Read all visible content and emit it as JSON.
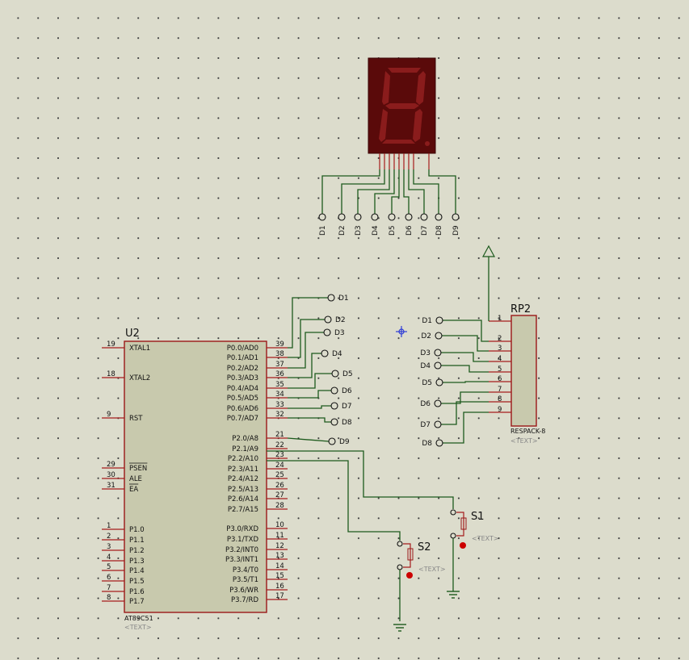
{
  "mcu": {
    "ref": "U2",
    "part": "AT89C51",
    "text": "<TEXT>",
    "pins": [
      {
        "num": "19",
        "name": "XTAL1"
      },
      {
        "num": "18",
        "name": "XTAL2"
      },
      {
        "num": "9",
        "name": "RST"
      },
      {
        "num": "29",
        "name": "PSEN"
      },
      {
        "num": "30",
        "name": "ALE"
      },
      {
        "num": "31",
        "name": "EA"
      },
      {
        "num": "1",
        "name": "P1.0"
      },
      {
        "num": "2",
        "name": "P1.1"
      },
      {
        "num": "3",
        "name": "P1.2"
      },
      {
        "num": "4",
        "name": "P1.3"
      },
      {
        "num": "5",
        "name": "P1.4"
      },
      {
        "num": "6",
        "name": "P1.5"
      },
      {
        "num": "7",
        "name": "P1.6"
      },
      {
        "num": "8",
        "name": "P1.7"
      },
      {
        "num": "39",
        "name": "P0.0/AD0"
      },
      {
        "num": "38",
        "name": "P0.1/AD1"
      },
      {
        "num": "37",
        "name": "P0.2/AD2"
      },
      {
        "num": "36",
        "name": "P0.3/AD3"
      },
      {
        "num": "35",
        "name": "P0.4/AD4"
      },
      {
        "num": "34",
        "name": "P0.5/AD5"
      },
      {
        "num": "33",
        "name": "P0.6/AD6"
      },
      {
        "num": "32",
        "name": "P0.7/AD7"
      },
      {
        "num": "21",
        "name": "P2.0/A8"
      },
      {
        "num": "22",
        "name": "P2.1/A9"
      },
      {
        "num": "23",
        "name": "P2.2/A10"
      },
      {
        "num": "24",
        "name": "P2.3/A11"
      },
      {
        "num": "25",
        "name": "P2.4/A12"
      },
      {
        "num": "26",
        "name": "P2.5/A13"
      },
      {
        "num": "27",
        "name": "P2.6/A14"
      },
      {
        "num": "28",
        "name": "P2.7/A15"
      },
      {
        "num": "10",
        "name": "P3.0/RXD"
      },
      {
        "num": "11",
        "name": "P3.1/TXD"
      },
      {
        "num": "12",
        "name": "P3.2/INT0"
      },
      {
        "num": "13",
        "name": "P3.3/INT1"
      },
      {
        "num": "14",
        "name": "P3.4/T0"
      },
      {
        "num": "15",
        "name": "P3.5/T1"
      },
      {
        "num": "16",
        "name": "P3.6/WR"
      },
      {
        "num": "17",
        "name": "P3.7/RD"
      }
    ]
  },
  "mcu_net_labels": [
    "D1",
    "D2",
    "D3",
    "D4",
    "D5",
    "D6",
    "D7",
    "D8",
    "D9"
  ],
  "display_terminals": [
    "D1",
    "D2",
    "D3",
    "D4",
    "D5",
    "D6",
    "D7",
    "D8",
    "D9"
  ],
  "respack": {
    "ref": "RP2",
    "part": "RESPACK-8",
    "text": "<TEXT>",
    "pins": [
      "1",
      "2",
      "3",
      "4",
      "5",
      "6",
      "7",
      "8",
      "9"
    ],
    "terminals": [
      "D1",
      "D2",
      "D3",
      "D4",
      "D5",
      "D6",
      "D7",
      "D8"
    ]
  },
  "switches": [
    {
      "ref": "S1",
      "text": "<TEXT>"
    },
    {
      "ref": "S2",
      "text": "<TEXT>"
    }
  ],
  "colors": {
    "background": "#dcdccc",
    "wire": "#1d5a1d",
    "component_outline": "#9a1818",
    "component_fill": "#c8c9ad",
    "display_body": "#5a0a0a",
    "segment_off": "#8a1c1c",
    "switch_dot": "#cc0000"
  }
}
